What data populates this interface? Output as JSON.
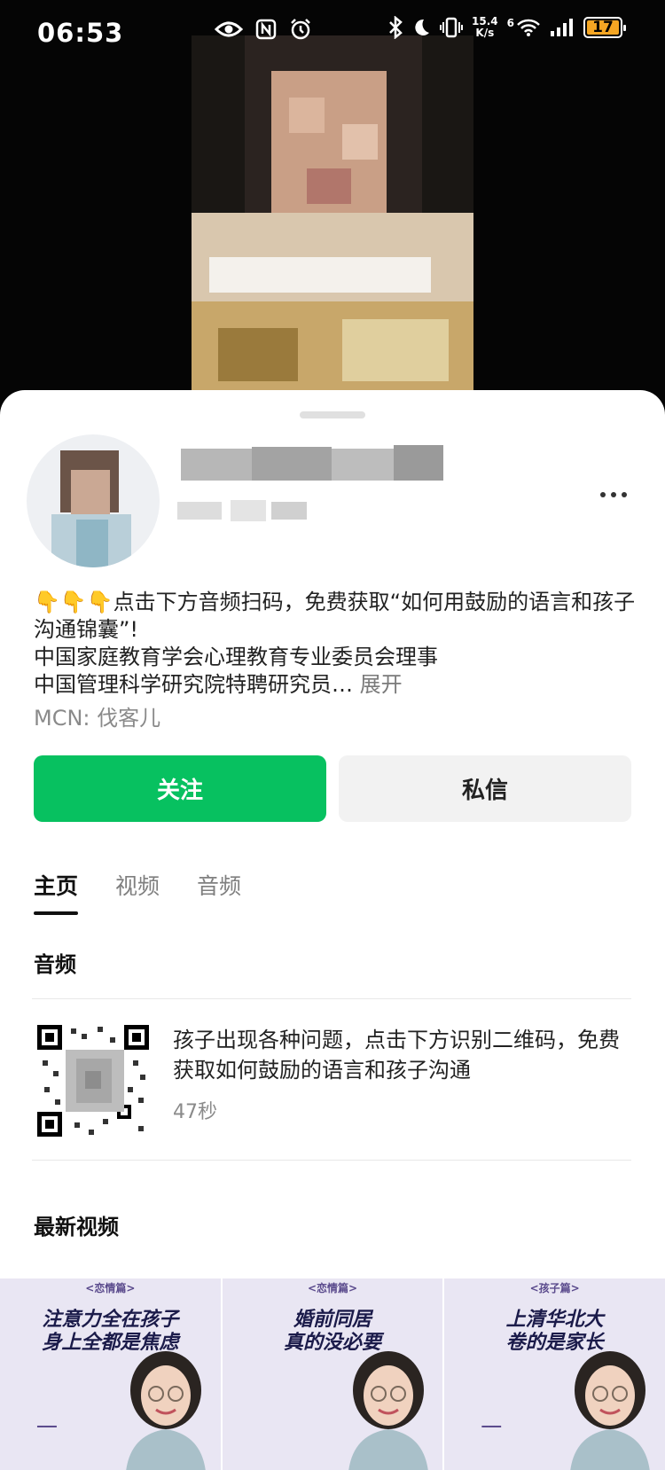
{
  "status_bar": {
    "time": "06:53",
    "net_speed_value": "15.4",
    "net_speed_unit": "K/s",
    "signal_label": "6",
    "battery": "17",
    "left_icons": [
      "eye-icon",
      "nfc-icon",
      "alarm-icon"
    ],
    "right_icons": [
      "bluetooth-icon",
      "moon-icon",
      "vibrate-icon",
      "wifi-icon",
      "signal-icon",
      "battery-icon"
    ]
  },
  "profile": {
    "bio_line1": "👇👇👇点击下方音频扫码，免费获取“如何用鼓励的语言和孩子沟通锦囊”!",
    "bio_line2": "中国家庭教育学会心理教育专业委员会理事",
    "bio_line3": "中国管理科学研究院特聘研究员…",
    "expand_label": " 展开",
    "mcn": "MCN: 伐客儿"
  },
  "actions": {
    "follow_label": "关注",
    "message_label": "私信"
  },
  "tabs": [
    {
      "label": "主页",
      "active": true
    },
    {
      "label": "视频",
      "active": false
    },
    {
      "label": "音频",
      "active": false
    }
  ],
  "audio_section": {
    "title": "音频",
    "item_text": "孩子出现各种问题，点击下方识别二维码，免费获取如何鼓励的语言和孩子沟通",
    "item_duration": "47秒"
  },
  "latest_videos": {
    "title": "最新视频",
    "items": [
      {
        "category": "<恋情篇>",
        "title": "注意力全在孩子\n身上全都是焦虑"
      },
      {
        "category": "<恋情篇>",
        "title": "婚前同居\n真的没必要"
      },
      {
        "category": "<孩子篇>",
        "title": "上清华北大\n卷的是家长"
      }
    ]
  },
  "colors": {
    "follow_green": "#07c160",
    "thumb_bg": "#e9e6f3",
    "battery": "#f5a623"
  }
}
